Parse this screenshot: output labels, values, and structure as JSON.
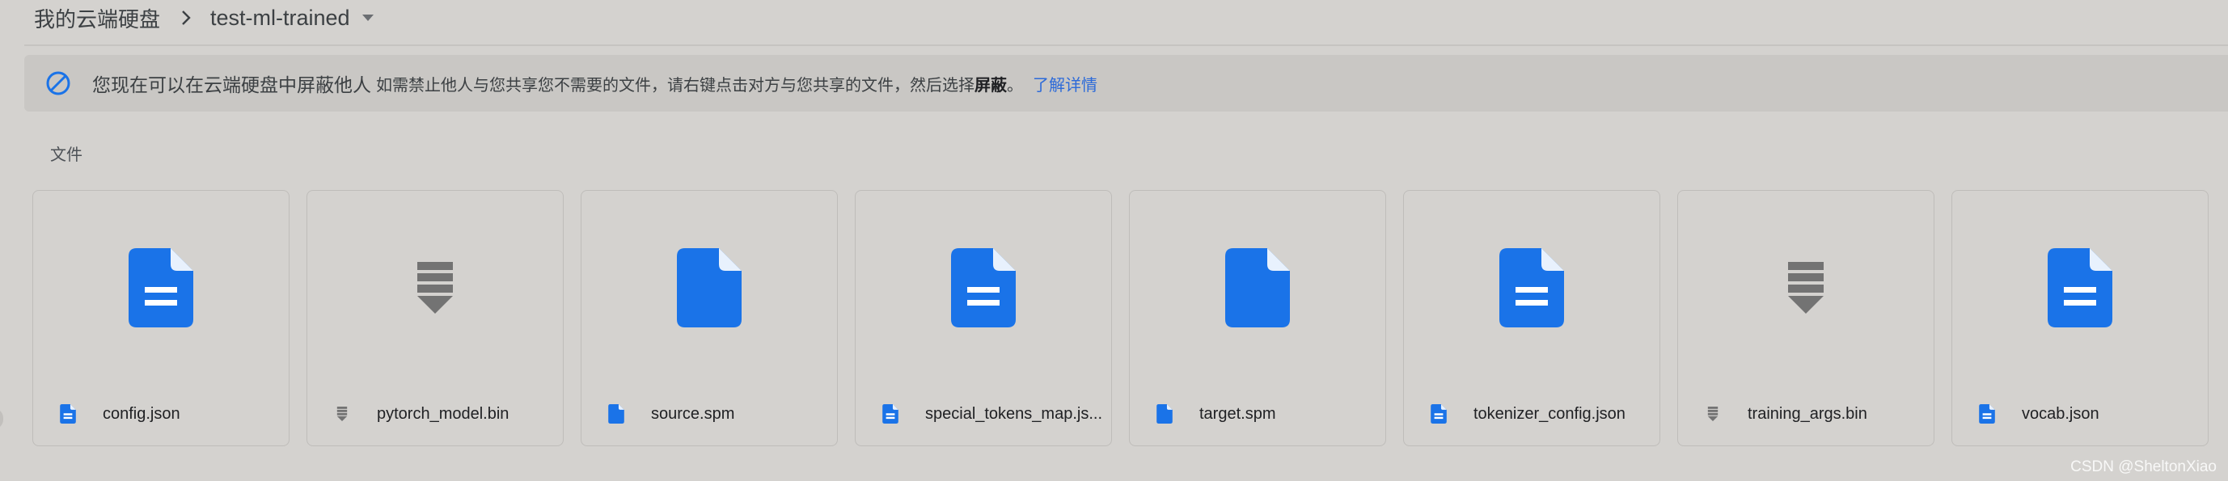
{
  "breadcrumb": {
    "root": "我的云端硬盘",
    "current": "test-ml-trained",
    "separator_icon": "chevron-right-icon",
    "dropdown_icon": "caret-down-icon"
  },
  "banner": {
    "icon": "block-icon",
    "title": "您现在可以在云端硬盘中屏蔽他人",
    "description": "如需禁止他人与您共享您不需要的文件，请右键点击对方与您共享的文件，然后选择",
    "bold_text": "屏蔽",
    "period": "。",
    "link": "了解详情"
  },
  "section": {
    "label": "文件"
  },
  "files": [
    {
      "name": "config.json",
      "type": "doc"
    },
    {
      "name": "pytorch_model.bin",
      "type": "binary"
    },
    {
      "name": "source.spm",
      "type": "blank"
    },
    {
      "name": "special_tokens_map.js...",
      "type": "doc"
    },
    {
      "name": "target.spm",
      "type": "blank"
    },
    {
      "name": "tokenizer_config.json",
      "type": "doc"
    },
    {
      "name": "training_args.bin",
      "type": "binary"
    },
    {
      "name": "vocab.json",
      "type": "doc"
    }
  ],
  "watermark": "CSDN @SheltonXiao",
  "colors": {
    "doc_blue": "#1a73e8",
    "binary_gray": "#737373",
    "link_blue": "#2c6ad9",
    "background": "#d4d2cf"
  }
}
